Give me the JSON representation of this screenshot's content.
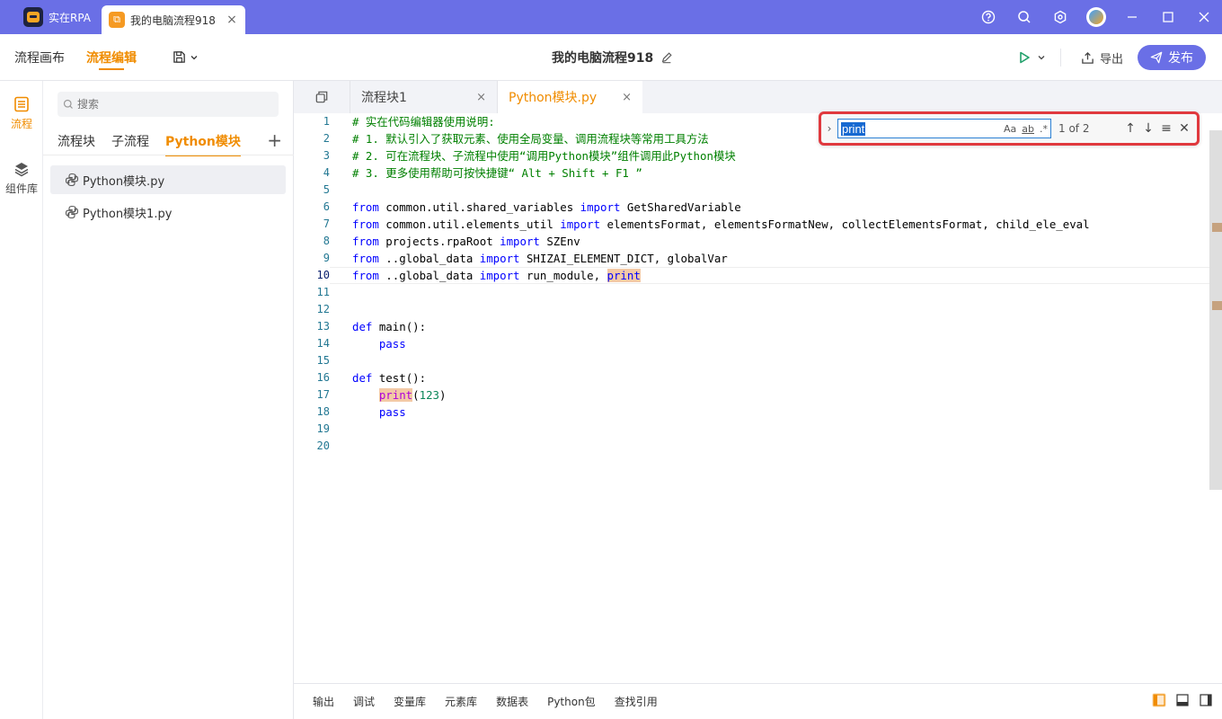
{
  "titlebar": {
    "app_name": "实在RPA",
    "tab_title": "我的电脑流程918",
    "tab_close": "×",
    "accent": "#6a6fe6"
  },
  "toolbar": {
    "tab_canvas": "流程画布",
    "tab_edit": "流程编辑",
    "flow_title": "我的电脑流程918",
    "export_label": "导出",
    "publish_label": "发布"
  },
  "leftnav": {
    "flow_label": "流程",
    "components_label": "组件库"
  },
  "sidebar": {
    "search_placeholder": "搜索",
    "tabs": [
      "流程块",
      "子流程",
      "Python模块"
    ],
    "add": "+",
    "files": [
      "Python模块.py",
      "Python模块1.py"
    ]
  },
  "editor_tabs": [
    {
      "label": "流程块1",
      "close": "×"
    },
    {
      "label": "Python模块.py",
      "close": "×"
    }
  ],
  "find": {
    "value": "print",
    "count": "1 of 2",
    "match_case": "Aa",
    "whole_word": "ab",
    "regex": ".*"
  },
  "code": {
    "line_numbers": [
      "1",
      "2",
      "3",
      "4",
      "5",
      "6",
      "7",
      "8",
      "9",
      "10",
      "11",
      "12",
      "13",
      "14",
      "15",
      "16",
      "17",
      "18",
      "19",
      "20"
    ],
    "current_line": 10
  },
  "bottom_tabs": [
    "输出",
    "调试",
    "变量库",
    "元素库",
    "数据表",
    "Python包",
    "查找引用"
  ]
}
